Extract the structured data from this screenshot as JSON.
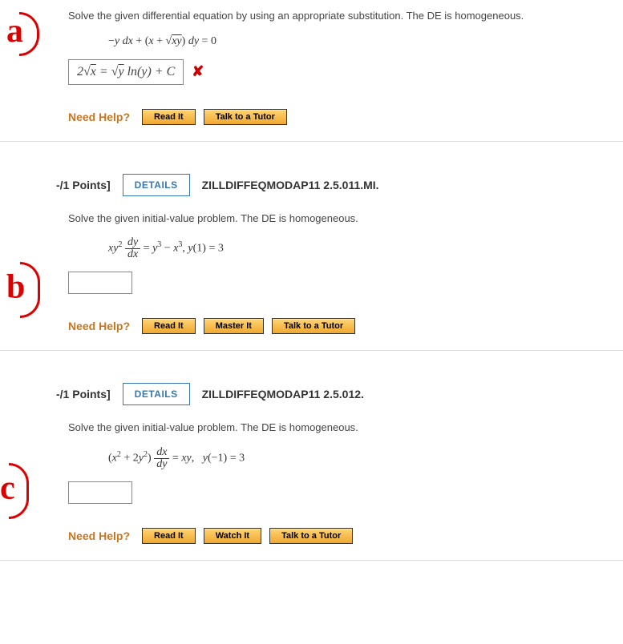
{
  "q1": {
    "instruction": "Solve the given differential equation by using an appropriate substitution. The DE is homogeneous.",
    "equation": "−y dx + (x + √(xy)) dy = 0",
    "answer": "2√x = √y ln(y) + C",
    "need_help": "Need Help?",
    "read_it": "Read It",
    "talk_tutor": "Talk to a Tutor",
    "annotation": "a"
  },
  "q2": {
    "points": "-/1 Points]",
    "details": "DETAILS",
    "topic": "ZILLDIFFEQMODAP11 2.5.011.MI.",
    "instruction": "Solve the given initial-value problem. The DE is homogeneous.",
    "equation": "xy² dy/dx = y³ − x³, y(1) = 3",
    "need_help": "Need Help?",
    "read_it": "Read It",
    "master_it": "Master It",
    "talk_tutor": "Talk to a Tutor",
    "annotation": "b"
  },
  "q3": {
    "points": "-/1 Points]",
    "details": "DETAILS",
    "topic": "ZILLDIFFEQMODAP11 2.5.012.",
    "instruction": "Solve the given initial-value problem. The DE is homogeneous.",
    "equation": "(x² + 2y²) dx/dy = xy,   y(−1) = 3",
    "need_help": "Need Help?",
    "read_it": "Read It",
    "watch_it": "Watch It",
    "talk_tutor": "Talk to a Tutor",
    "annotation": "c"
  }
}
